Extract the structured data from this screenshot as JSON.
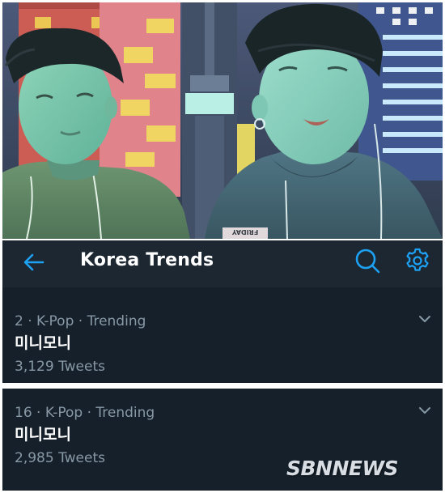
{
  "header": {
    "title": "Korea Trends"
  },
  "trends": [
    {
      "position": "2",
      "category": "K-Pop",
      "status": "Trending",
      "meta": "2 · K-Pop · Trending",
      "name": "미니모니",
      "tweets": "3,129 Tweets"
    },
    {
      "position": "16",
      "category": "K-Pop",
      "status": "Trending",
      "meta": "16 · K-Pop · Trending",
      "name": "미니모니",
      "tweets": "2,985 Tweets"
    }
  ],
  "photo": {
    "shirt_tag": "FRIDAY"
  },
  "watermark": "SBNNEWS",
  "colors": {
    "app_background": "#15202b",
    "header_background": "#1c2732",
    "accent": "#1da1f2",
    "secondary_text": "#8899a6",
    "primary_text": "#ffffff"
  },
  "icons": [
    "back-arrow-icon",
    "search-icon",
    "settings-gear-icon",
    "chevron-down-icon"
  ]
}
